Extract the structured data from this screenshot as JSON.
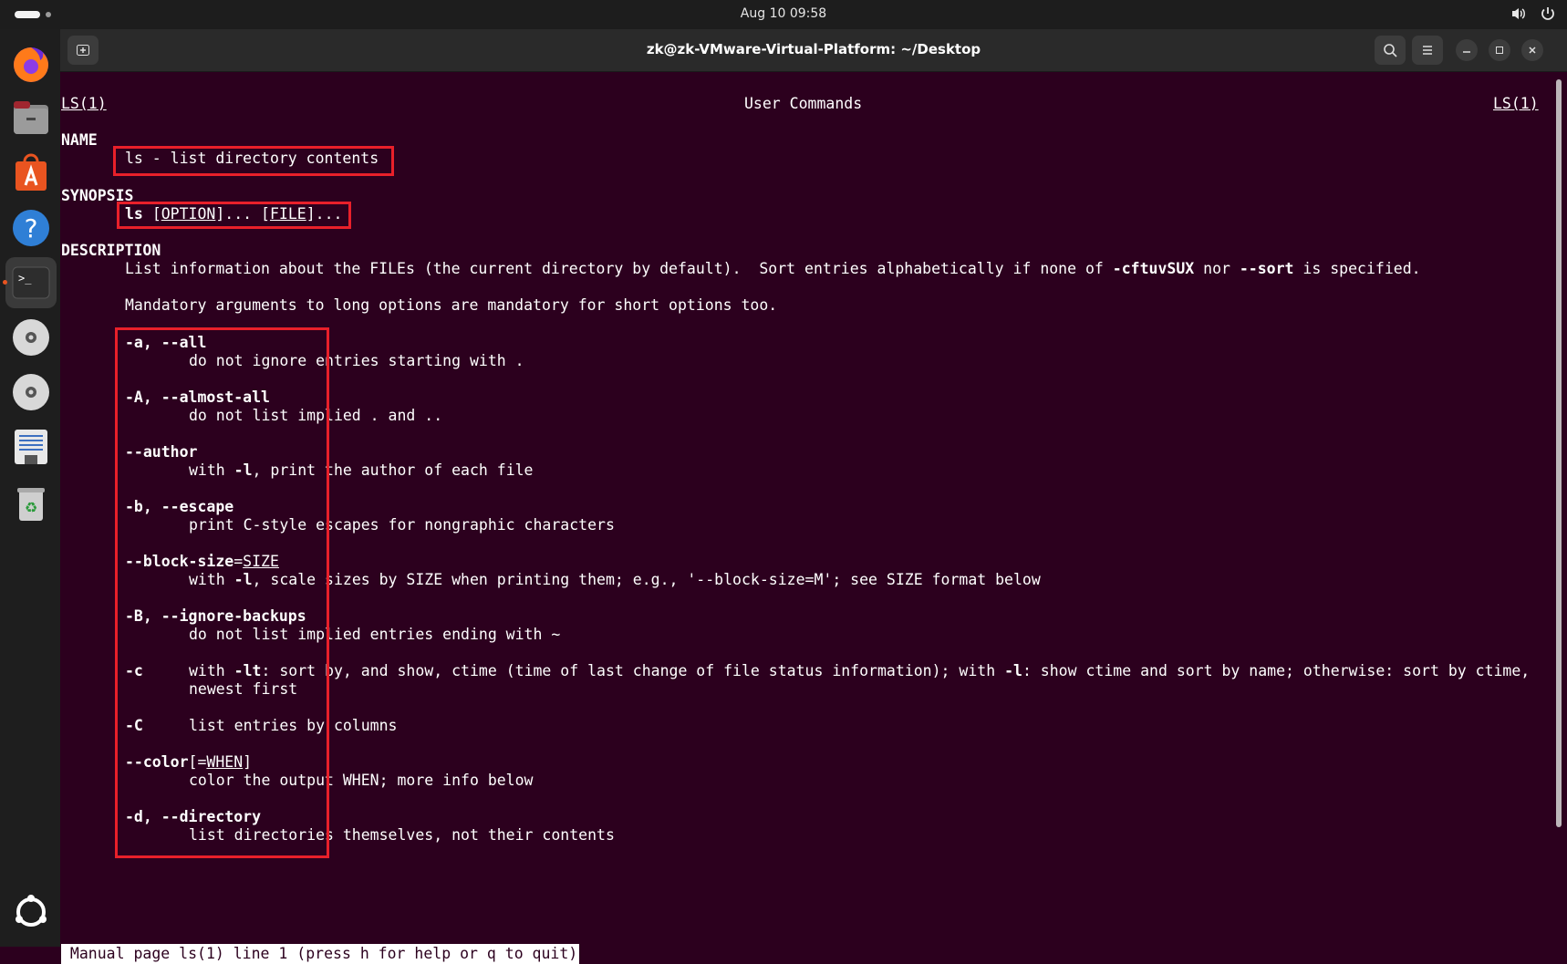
{
  "topbar": {
    "datetime": "Aug 10  09:58",
    "tray_icons": [
      "speaker-icon",
      "power-icon"
    ]
  },
  "dock": {
    "items": [
      "firefox",
      "files",
      "app-center",
      "help",
      "terminal",
      "disc",
      "disc",
      "text-editor",
      "trash"
    ],
    "active": "terminal"
  },
  "window": {
    "title": "zk@zk-VMware-Virtual-Platform: ~/Desktop"
  },
  "man": {
    "header_left": "LS(1)",
    "header_center": "User Commands",
    "header_right": "LS(1)",
    "name_heading": "NAME",
    "name_line": "ls - list directory contents",
    "synopsis_heading": "SYNOPSIS",
    "synopsis": {
      "cmd": "ls",
      "sp": " ",
      "lb1": "[",
      "opt": "OPTION",
      "rb1": "]... ",
      "lb2": "[",
      "file": "FILE",
      "rb2": "]..."
    },
    "description_heading": "DESCRIPTION",
    "desc1": {
      "a": "List information about the FILEs (the current directory by default).  Sort entries alphabetically if none of ",
      "b": "-cftuvSUX",
      "c": " nor ",
      "d": "--sort",
      "e": " is specified."
    },
    "desc2": "Mandatory arguments to long options are mandatory for short options too.",
    "options": [
      {
        "flag": "-a, --all",
        "desc": "do not ignore entries starting with ."
      },
      {
        "flag": "-A, --almost-all",
        "desc": "do not list implied . and .."
      },
      {
        "flag": "--author",
        "desc_pre": "with ",
        "desc_bold": "-l",
        "desc_post": ", print the author of each file"
      },
      {
        "flag": "-b, --escape",
        "desc": "print C-style escapes for nongraphic characters"
      },
      {
        "flag": "--block-size",
        "flag_eq": "=",
        "flag_arg": "SIZE",
        "desc_pre": "with ",
        "desc_bold": "-l",
        "desc_post": ", scale sizes by SIZE when printing them; e.g., '--block-size=M'; see SIZE format below"
      },
      {
        "flag": "-B, --ignore-backups",
        "desc": "do not list implied entries ending with ~"
      },
      {
        "flag": "-c",
        "desc_pre": "with ",
        "desc_bold": "-lt",
        "desc_mid": ": sort by, and show, ctime (time of last change of file status information); with ",
        "desc_bold2": "-l",
        "desc_post": ": show ctime and sort by name; otherwise: sort by ctime,",
        "desc_line2": "newest first"
      },
      {
        "flag": "-C",
        "desc": "list entries by columns"
      },
      {
        "flag": "--color",
        "flag_lb": "[=",
        "flag_arg": "WHEN",
        "flag_rb": "]",
        "desc": "color the output WHEN; more info below"
      },
      {
        "flag": "-d, --directory",
        "desc": "list directories themselves, not their contents"
      }
    ],
    "status": " Manual page ls(1) line 1 (press h for help or q to quit)"
  }
}
